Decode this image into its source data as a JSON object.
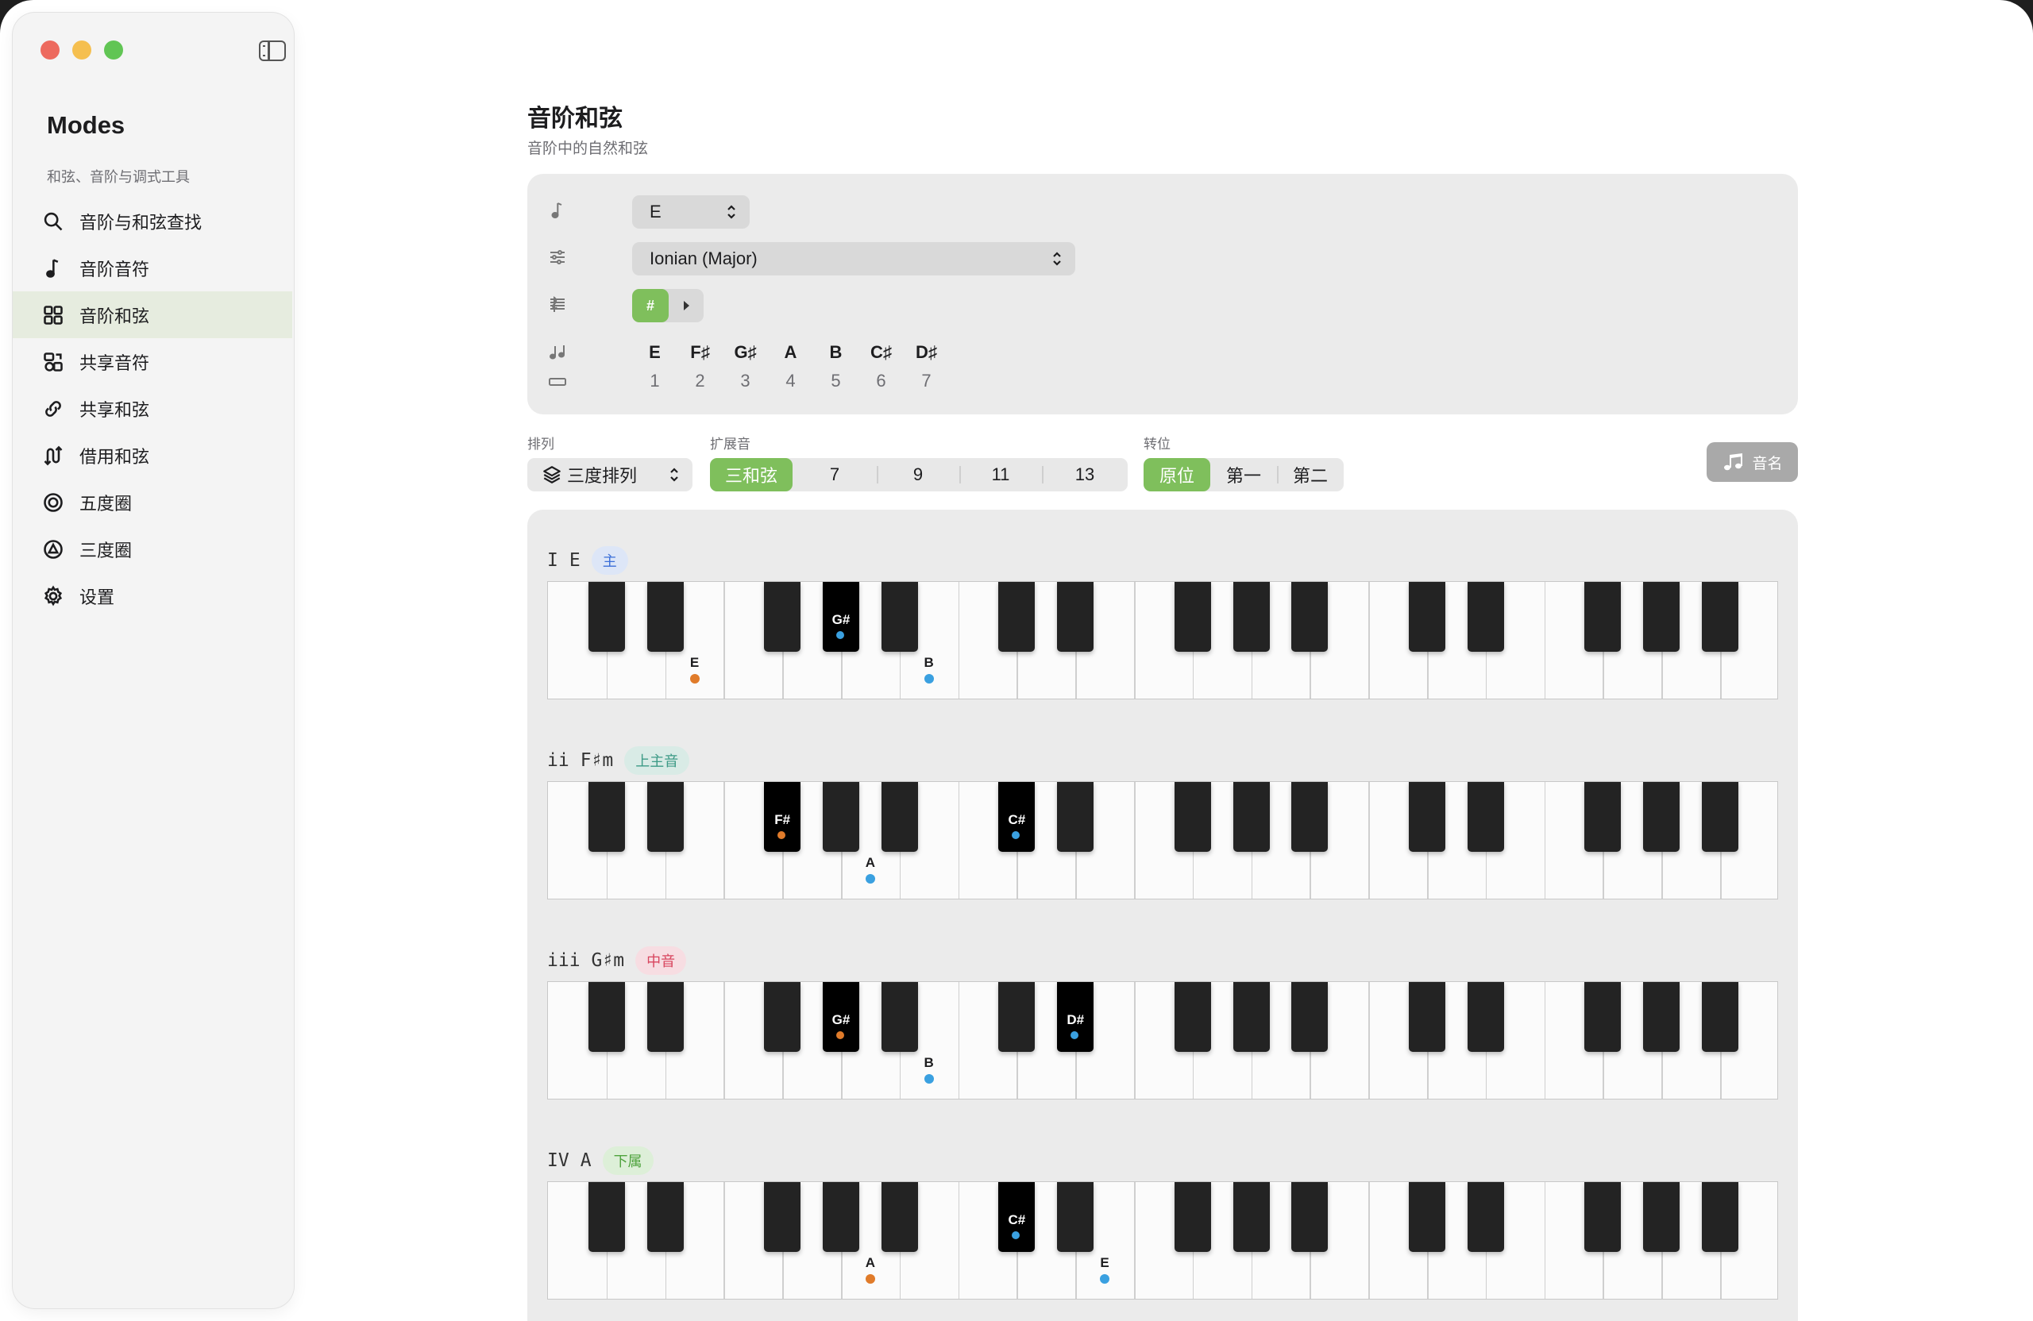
{
  "sidebar": {
    "app_title": "Modes",
    "subtitle": "和弦、音阶与调式工具",
    "items": [
      {
        "label": "音阶与和弦查找",
        "icon": "search-icon"
      },
      {
        "label": "音阶音符",
        "icon": "music-note-icon"
      },
      {
        "label": "音阶和弦",
        "icon": "grid-icon",
        "active": true
      },
      {
        "label": "共享音符",
        "icon": "shapes-icon"
      },
      {
        "label": "共享和弦",
        "icon": "link-icon"
      },
      {
        "label": "借用和弦",
        "icon": "arrows-icon"
      },
      {
        "label": "五度圈",
        "icon": "circle-icon"
      },
      {
        "label": "三度圈",
        "icon": "triangle-circle-icon"
      },
      {
        "label": "设置",
        "icon": "gear-icon"
      }
    ]
  },
  "page": {
    "title": "音阶和弦",
    "subtitle": "音阶中的自然和弦"
  },
  "scale_panel": {
    "key_value": "E",
    "mode_value": "Ionian (Major)",
    "accidental_on": "#",
    "accidental_off": "♭",
    "notes": [
      "E",
      "F♯",
      "G♯",
      "A",
      "B",
      "C♯",
      "D♯"
    ],
    "degrees": [
      "1",
      "2",
      "3",
      "4",
      "5",
      "6",
      "7"
    ]
  },
  "controls": {
    "arrangement_label": "排列",
    "arrangement_value": "三度排列",
    "extension_label": "扩展音",
    "extensions": [
      "三和弦",
      "7",
      "9",
      "11",
      "13"
    ],
    "extension_selected": 0,
    "inversion_label": "转位",
    "inversions": [
      "原位",
      "第一",
      "第二"
    ],
    "inversion_selected": 0,
    "note_name_button": "音名"
  },
  "colors": {
    "accent_green": "#7fbf5c",
    "root_dot": "#e07b2a",
    "tone_dot": "#3aa0e0"
  },
  "chords": [
    {
      "numeral": "I",
      "symbol": "E",
      "function": "主",
      "badge_bg": "#dde6f7",
      "badge_fg": "#3c6fd8",
      "notes": [
        {
          "name": "E",
          "white": 2,
          "root": true
        },
        {
          "name": "G#",
          "black": 3,
          "root": false
        },
        {
          "name": "B",
          "white": 6,
          "root": false
        }
      ]
    },
    {
      "numeral": "ii",
      "symbol": "F♯m",
      "function": "上主音",
      "badge_bg": "#d9ebe6",
      "badge_fg": "#3d9a86",
      "notes": [
        {
          "name": "F#",
          "black": 2,
          "root": true
        },
        {
          "name": "A",
          "white": 5,
          "root": false
        },
        {
          "name": "C#",
          "black": 5,
          "root": false
        }
      ]
    },
    {
      "numeral": "iii",
      "symbol": "G♯m",
      "function": "中音",
      "badge_bg": "#f7dde2",
      "badge_fg": "#d8455e",
      "notes": [
        {
          "name": "G#",
          "black": 3,
          "root": true
        },
        {
          "name": "B",
          "white": 6,
          "root": false
        },
        {
          "name": "D#",
          "black": 6,
          "root": false
        }
      ]
    },
    {
      "numeral": "IV",
      "symbol": "A",
      "function": "下属",
      "badge_bg": "#ddefd8",
      "badge_fg": "#4fa33e",
      "notes": [
        {
          "name": "A",
          "white": 5,
          "root": true
        },
        {
          "name": "C#",
          "black": 5,
          "root": false
        },
        {
          "name": "E",
          "white": 9,
          "root": false
        }
      ]
    }
  ]
}
